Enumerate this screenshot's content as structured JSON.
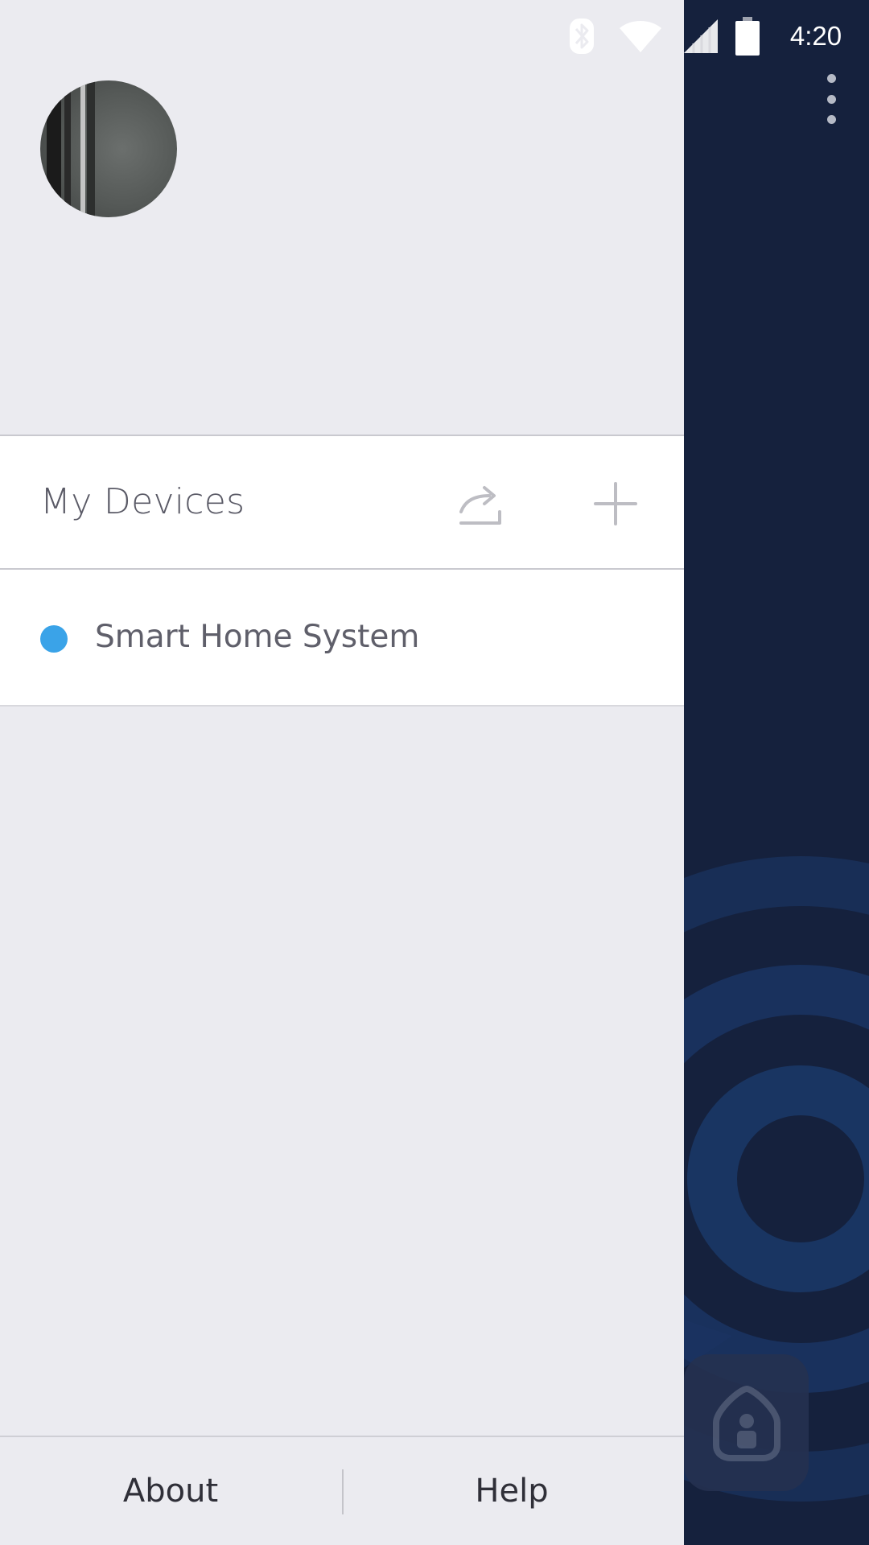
{
  "status_bar": {
    "time": "4:20",
    "icons": [
      "bluetooth-icon",
      "wifi-icon",
      "cell-signal-icon",
      "battery-icon"
    ]
  },
  "drawer": {
    "devices_header": {
      "title": "My Devices",
      "share_icon": "share-icon",
      "add_icon": "plus-icon"
    },
    "devices": [
      {
        "name": "Smart Home System",
        "status_color": "#3aa3e8"
      }
    ],
    "footer": {
      "about_label": "About",
      "help_label": "Help"
    }
  },
  "background_app": {
    "overflow_icon": "more-vert-icon",
    "home_button_icon": "home-lock-icon"
  },
  "colors": {
    "drawer_background": "#ebebf0",
    "app_background": "#15213d",
    "accent_blue": "#3aa3e8"
  }
}
